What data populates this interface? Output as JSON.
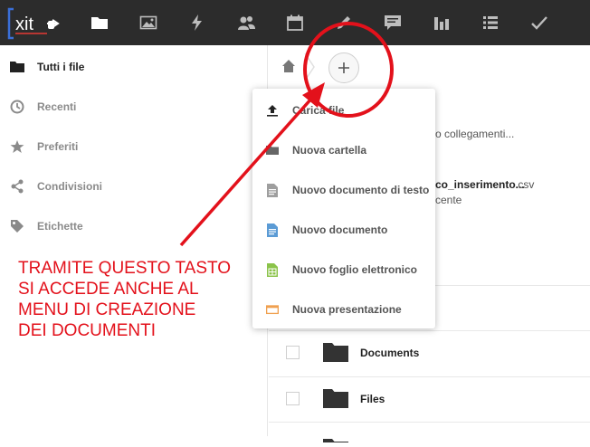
{
  "app": {
    "logo_text": "xit"
  },
  "topnav": {
    "icons": [
      "folder-icon",
      "image-icon",
      "bolt-icon",
      "contacts-icon",
      "calendar-icon",
      "pencil-icon",
      "chat-icon",
      "bar-chart-icon",
      "list-icon",
      "check-icon"
    ]
  },
  "sidebar": {
    "items": [
      {
        "label": "Tutti i file",
        "icon": "folder-icon"
      },
      {
        "label": "Recenti",
        "icon": "clock-icon"
      },
      {
        "label": "Preferiti",
        "icon": "star-icon"
      },
      {
        "label": "Condivisioni",
        "icon": "share-icon"
      },
      {
        "label": "Etichette",
        "icon": "tag-icon"
      }
    ]
  },
  "main": {
    "partial_rows": [
      "o collegamenti...",
      "co_inserimento...",
      ".csv",
      "cente"
    ],
    "files": [
      {
        "name": "Documents"
      },
      {
        "name": "Files"
      }
    ]
  },
  "new_menu": {
    "items": [
      {
        "label": "Carica file",
        "icon": "upload-icon",
        "color": "#222222"
      },
      {
        "label": "Nuova cartella",
        "icon": "folder-icon",
        "color": "#666666"
      },
      {
        "label": "Nuovo documento di testo",
        "icon": "text-file-icon",
        "color": "#9e9e9e"
      },
      {
        "label": "Nuovo documento",
        "icon": "document-icon",
        "color": "#5b9bd5"
      },
      {
        "label": "Nuovo foglio elettronico",
        "icon": "spreadsheet-icon",
        "color": "#8bc34a"
      },
      {
        "label": "Nuova presentazione",
        "icon": "presentation-icon",
        "color": "#f0a050"
      }
    ]
  },
  "annotation": {
    "lines": [
      "TRAMITE QUESTO TASTO",
      "SI ACCEDE ANCHE AL",
      "MENU DI CREAZIONE",
      "DEI DOCUMENTI"
    ],
    "color": "#e3111b"
  }
}
